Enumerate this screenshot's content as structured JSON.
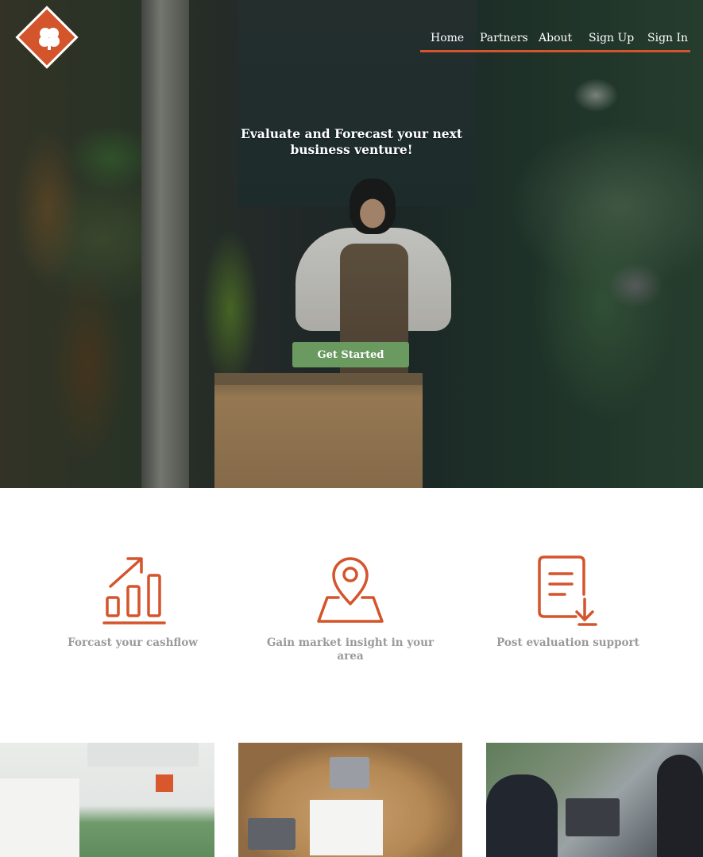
{
  "brand": {
    "accent_color": "#d4542b",
    "button_color": "#6a9a60",
    "logo_icon": "diamond-logo-icon"
  },
  "nav": {
    "items": [
      {
        "label": "Home"
      },
      {
        "label": "Partners"
      },
      {
        "label": "About"
      },
      {
        "label": "Sign Up"
      },
      {
        "label": "Sign In"
      }
    ]
  },
  "hero": {
    "title": "Evaluate and Forecast your next business venture!",
    "cta_label": "Get Started",
    "background": "florist-shop-photo"
  },
  "features": [
    {
      "icon": "bar-chart-growth-icon",
      "label": "Forcast your cashflow"
    },
    {
      "icon": "map-pin-icon",
      "label": "Gain market insight in your area"
    },
    {
      "icon": "document-download-icon",
      "label": "Post evaluation support"
    }
  ],
  "photos": [
    {
      "subject": "kitchen-interior-photo"
    },
    {
      "subject": "team-meeting-table-photo"
    },
    {
      "subject": "business-people-laptop-photo"
    }
  ]
}
